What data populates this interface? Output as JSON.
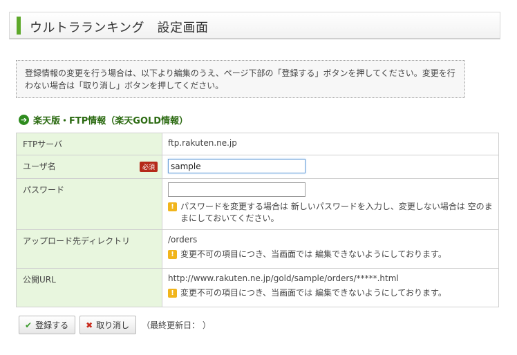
{
  "header": {
    "title": "ウルトラランキング　設定画面"
  },
  "notice": {
    "text": "登録情報の変更を行う場合は、以下より編集のうえ、ページ下部の「登録する」ボタンを押してください。変更を行わない場合は「取り消し」ボタンを押してください。"
  },
  "section": {
    "title": "楽天版・FTP情報（楽天GOLD情報）",
    "icon": "arrow-right-circle-icon"
  },
  "form": {
    "ftp_server": {
      "label": "FTPサーバ",
      "value": "ftp.rakuten.ne.jp"
    },
    "username": {
      "label": "ユーザ名",
      "required": "必須",
      "value": "sample"
    },
    "password": {
      "label": "パスワード",
      "value": "",
      "note": "パスワードを変更する場合は 新しいパスワードを入力し、変更しない場合は 空のままにしておいてください。"
    },
    "upload_dir": {
      "label": "アップロード先ディレクトリ",
      "value": "/orders",
      "note": "変更不可の項目につき、当画面では 編集できないようにしております。"
    },
    "public_url": {
      "label": "公開URL",
      "value": "http://www.rakuten.ne.jp/gold/sample/orders/*****.html",
      "note": "変更不可の項目につき、当画面では 編集できないようにしております。"
    }
  },
  "buttons": {
    "register": "登録する",
    "cancel": "取り消し"
  },
  "last_updated": {
    "text": "（最終更新日：  ）"
  },
  "colors": {
    "accent": "#5da82a",
    "label_bg": "#e8f6de",
    "section_title": "#2b6a11",
    "required_badge": "#b5291a",
    "note_icon": "#f1b51c"
  }
}
